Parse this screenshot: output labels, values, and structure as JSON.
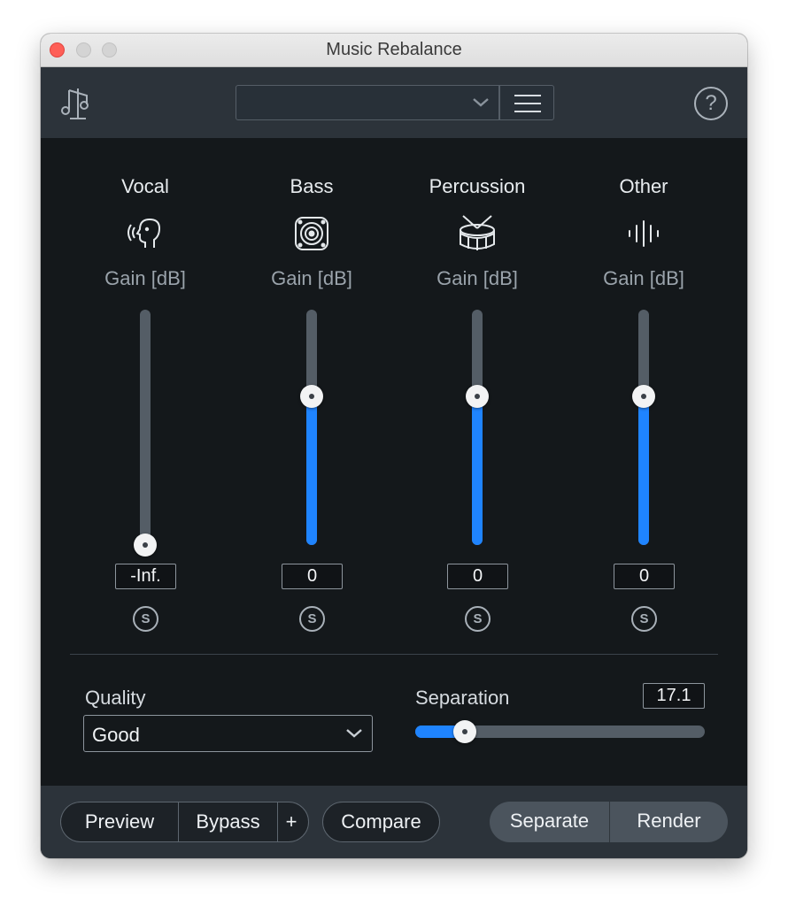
{
  "window": {
    "title": "Music Rebalance"
  },
  "toolbar": {
    "preset_value": "",
    "logo_icon": "music-rebalance-logo-icon",
    "menu_icon": "hamburger-menu-icon",
    "help_icon": "help-icon",
    "help_glyph": "?"
  },
  "channels": [
    {
      "name": "Vocal",
      "icon": "vocal-head-icon",
      "gain_label": "Gain [dB]",
      "value": "-Inf.",
      "level": 0.0,
      "solo": "S"
    },
    {
      "name": "Bass",
      "icon": "speaker-icon",
      "gain_label": "Gain [dB]",
      "value": "0",
      "level": 0.63,
      "solo": "S"
    },
    {
      "name": "Percussion",
      "icon": "drum-icon",
      "gain_label": "Gain [dB]",
      "value": "0",
      "level": 0.63,
      "solo": "S"
    },
    {
      "name": "Other",
      "icon": "waveform-icon",
      "gain_label": "Gain [dB]",
      "value": "0",
      "level": 0.63,
      "solo": "S"
    }
  ],
  "quality": {
    "label": "Quality",
    "value": "Good"
  },
  "separation": {
    "label": "Separation",
    "value": "17.1",
    "level": 0.17
  },
  "footer": {
    "preview": "Preview",
    "bypass": "Bypass",
    "plus": "+",
    "compare": "Compare",
    "separate": "Separate",
    "render": "Render"
  },
  "colors": {
    "accent": "#1f84ff",
    "panel": "#14181b",
    "toolbar": "#2c333a"
  }
}
